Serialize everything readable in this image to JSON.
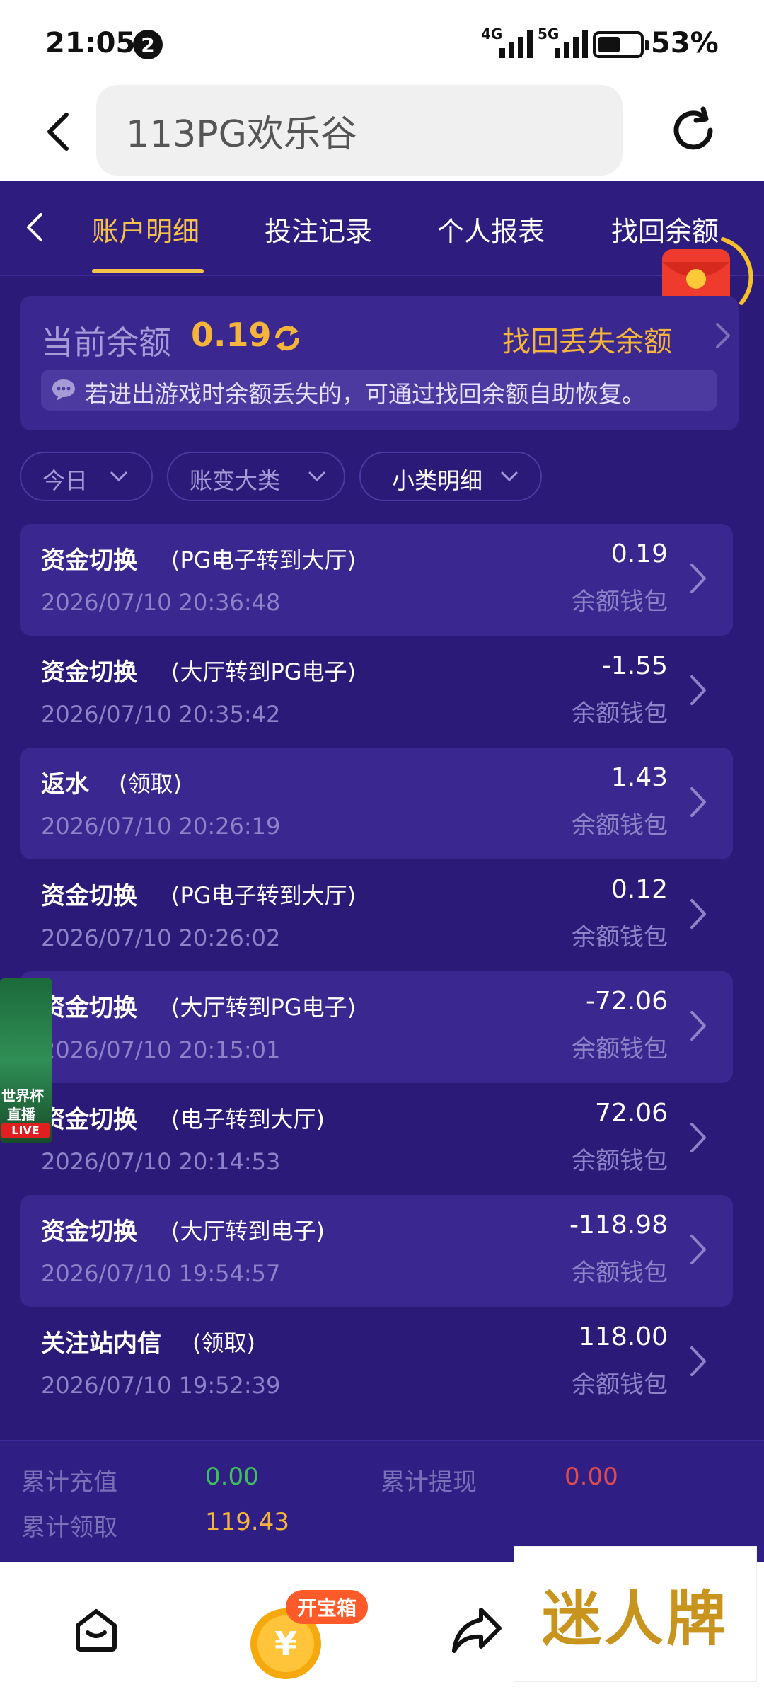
{
  "status_bar": {
    "time": "21:05",
    "notification_count": "2",
    "network1": "4G",
    "network2": "5G",
    "battery": "53%"
  },
  "browser": {
    "url_text": "113PG欢乐谷"
  },
  "tabs": [
    "账户明细",
    "投注记录",
    "个人报表",
    "找回余额"
  ],
  "balance": {
    "label": "当前余额",
    "value": "0.19",
    "recover_link": "找回丢失余额",
    "notice": "若进出游戏时余额丢失的，可通过找回余额自助恢复。"
  },
  "filters": [
    "今日",
    "账变大类",
    "小类明细"
  ],
  "records": [
    {
      "title": "资金切换",
      "detail": "(PG电子转到大厅)",
      "time": "2026/07/10 20:36:48",
      "amount": "0.19",
      "wallet": "余额钱包"
    },
    {
      "title": "资金切换",
      "detail": "(大厅转到PG电子)",
      "time": "2026/07/10 20:35:42",
      "amount": "-1.55",
      "wallet": "余额钱包"
    },
    {
      "title": "返水",
      "detail": "(领取)",
      "time": "2026/07/10 20:26:19",
      "amount": "1.43",
      "wallet": "余额钱包"
    },
    {
      "title": "资金切换",
      "detail": "(PG电子转到大厅)",
      "time": "2026/07/10 20:26:02",
      "amount": "0.12",
      "wallet": "余额钱包"
    },
    {
      "title": "资金切换",
      "detail": "(大厅转到PG电子)",
      "time": "2026/07/10 20:15:01",
      "amount": "-72.06",
      "wallet": "余额钱包"
    },
    {
      "title": "资金切换",
      "detail": "(电子转到大厅)",
      "time": "2026/07/10 20:14:53",
      "amount": "72.06",
      "wallet": "余额钱包"
    },
    {
      "title": "资金切换",
      "detail": "(大厅转到电子)",
      "time": "2026/07/10 19:54:57",
      "amount": "-118.98",
      "wallet": "余额钱包"
    },
    {
      "title": "关注站内信",
      "detail": "(领取)",
      "time": "2026/07/10 19:52:39",
      "amount": "118.00",
      "wallet": "余额钱包"
    }
  ],
  "totals": {
    "recharge_label": "累计充值",
    "recharge_value": "0.00",
    "withdraw_label": "累计提现",
    "withdraw_value": "0.00",
    "claimed_label": "累计领取",
    "claimed_value": "119.43"
  },
  "live_widget": {
    "line1": "世界杯",
    "line2": "直播",
    "badge": "LIVE"
  },
  "bottom_nav": {
    "treasure_badge": "开宝箱",
    "coin_symbol": "¥"
  },
  "watermark": "迷人牌",
  "colors": {
    "accent": "#f5c24b",
    "balance": "#f5b53a",
    "recharge": "#3fbf5a",
    "withdraw": "#e04a4a",
    "claimed": "#f5b53a",
    "background": "#2b1a78"
  }
}
